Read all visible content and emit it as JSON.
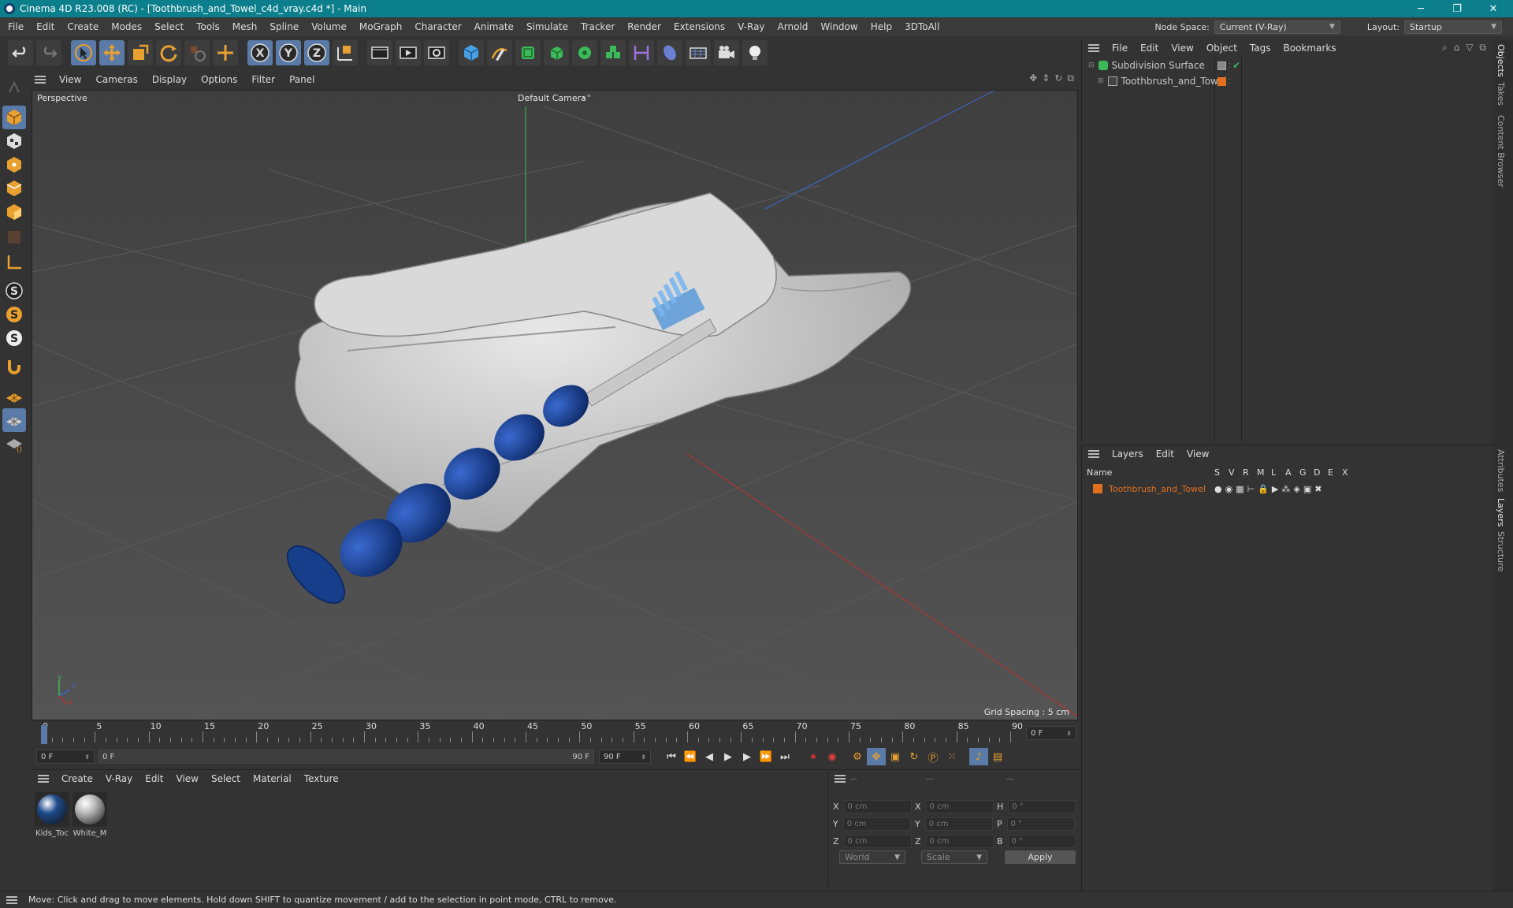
{
  "window": {
    "title": "Cinema 4D R23.008 (RC) - [Toothbrush_and_Towel_c4d_vray.c4d *] - Main",
    "minimize": "─",
    "maximize": "❐",
    "close": "✕"
  },
  "menubar": {
    "items": [
      "File",
      "Edit",
      "Create",
      "Modes",
      "Select",
      "Tools",
      "Mesh",
      "Spline",
      "Volume",
      "MoGraph",
      "Character",
      "Animate",
      "Simulate",
      "Tracker",
      "Render",
      "Extensions",
      "V-Ray",
      "Arnold",
      "Window",
      "Help",
      "3DToAll"
    ],
    "node_space_label": "Node Space:",
    "node_space_value": "Current (V-Ray)",
    "layout_label": "Layout:",
    "layout_value": "Startup"
  },
  "viewport": {
    "menu": [
      "View",
      "Cameras",
      "Display",
      "Options",
      "Filter",
      "Panel"
    ],
    "name": "Perspective",
    "camera": "Default Camera",
    "grid_spacing": "Grid Spacing : 5 cm",
    "axis_y": "y",
    "axis_z": "z",
    "axis_x": "x"
  },
  "timeline": {
    "ticks": [
      "0",
      "5",
      "10",
      "15",
      "20",
      "25",
      "30",
      "35",
      "40",
      "45",
      "50",
      "55",
      "60",
      "65",
      "70",
      "75",
      "80",
      "85",
      "90"
    ],
    "current_frame": "0 F",
    "range_end": "90 F",
    "transport_start": "0 F",
    "range_start": "0 F",
    "range_slider_end": "90 F",
    "end_field": "90 F"
  },
  "material_manager": {
    "menu": [
      "Create",
      "V-Ray",
      "Edit",
      "View",
      "Select",
      "Material",
      "Texture"
    ],
    "materials": [
      {
        "name": "Kids_Toc",
        "color": "#1d4a8a"
      },
      {
        "name": "White_M",
        "color": "#b8b8b8"
      }
    ]
  },
  "coordinates": {
    "headers": [
      "--",
      "--",
      "--"
    ],
    "rows": [
      {
        "a": "X",
        "av": "0 cm",
        "b": "X",
        "bv": "0 cm",
        "c": "H",
        "cv": "0 °"
      },
      {
        "a": "Y",
        "av": "0 cm",
        "b": "Y",
        "bv": "0 cm",
        "c": "P",
        "cv": "0 °"
      },
      {
        "a": "Z",
        "av": "0 cm",
        "b": "Z",
        "bv": "0 cm",
        "c": "B",
        "cv": "0 °"
      }
    ],
    "space": "World",
    "mode": "Scale",
    "apply": "Apply"
  },
  "object_manager": {
    "menu": [
      "File",
      "Edit",
      "View",
      "Object",
      "Tags",
      "Bookmarks"
    ],
    "objects": [
      {
        "name": "Subdivision Surface"
      },
      {
        "name": "Toothbrush_and_Towel"
      }
    ]
  },
  "layer_manager": {
    "menu": [
      "Layers",
      "Edit",
      "View"
    ],
    "columns": [
      "Name",
      "S",
      "V",
      "R",
      "M",
      "L",
      "A",
      "G",
      "D",
      "E",
      "X"
    ],
    "layers": [
      {
        "name": "Toothbrush_and_Towel",
        "color": "#e07020"
      }
    ]
  },
  "side_tabs": [
    "Objects",
    "Takes",
    "Content Browser",
    "Attributes",
    "Layers",
    "Structure"
  ],
  "status": "Move: Click and drag to move elements. Hold down SHIFT to quantize movement / add to the selection in point mode, CTRL to remove.",
  "colors": {
    "title_bar": "#0b7f8c",
    "accent_orange": "#e07020",
    "selected_blue": "#5a7aa8"
  }
}
